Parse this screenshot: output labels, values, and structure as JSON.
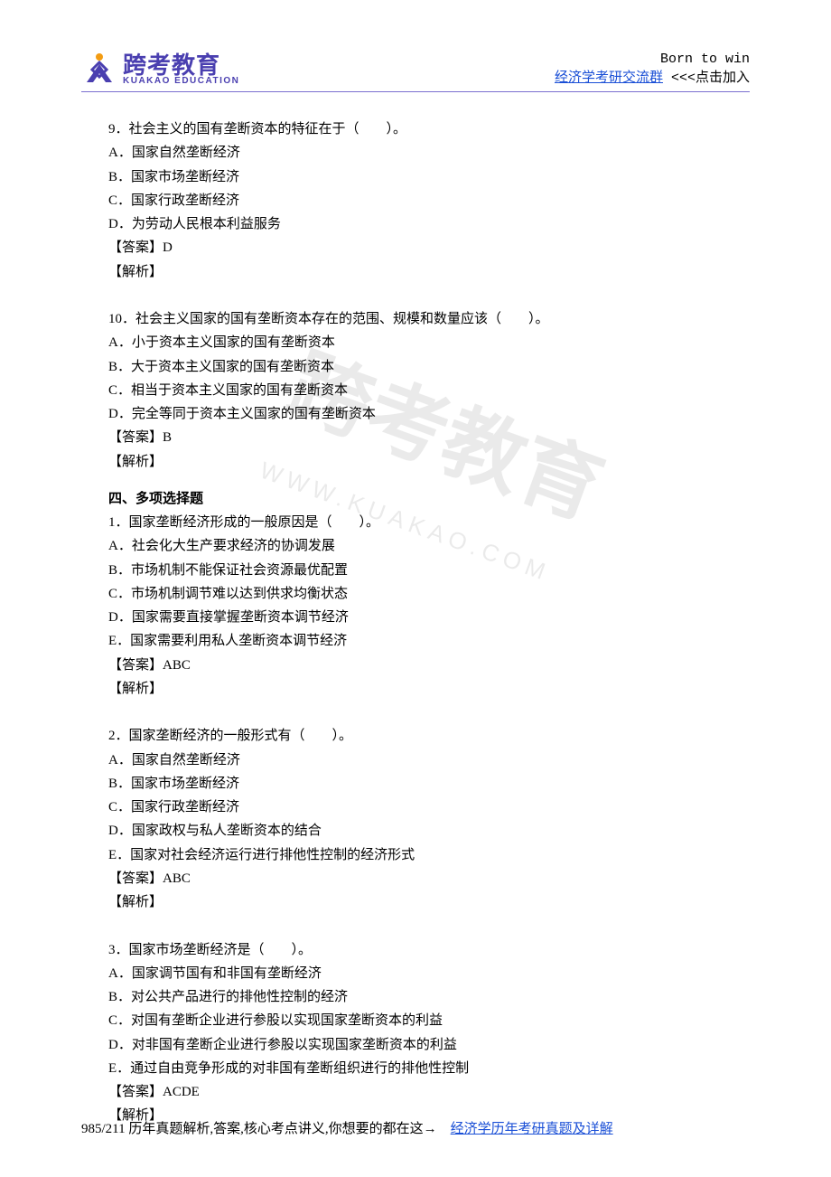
{
  "header": {
    "logo_cn": "跨考教育",
    "logo_en": "KUAKAO EDUCATION",
    "slogan": "Born to win",
    "link_text": "经济学考研交流群",
    "hint": " <<<点击加入"
  },
  "watermark": {
    "cn": "跨考教育",
    "en": "WWW.KUAKAO.COM"
  },
  "questions": [
    {
      "stem": "9．社会主义的国有垄断资本的特征在于（　　）。",
      "options": [
        "A．国家自然垄断经济",
        "B．国家市场垄断经济",
        "C．国家行政垄断经济",
        "D．为劳动人民根本利益服务"
      ],
      "answer": "【答案】D",
      "analysis": "【解析】"
    },
    {
      "stem": "10．社会主义国家的国有垄断资本存在的范围、规模和数量应该（　　）。",
      "options": [
        "A．小于资本主义国家的国有垄断资本",
        "B．大于资本主义国家的国有垄断资本",
        "C．相当于资本主义国家的国有垄断资本",
        "D．完全等同于资本主义国家的国有垄断资本"
      ],
      "answer": "【答案】B",
      "analysis": "【解析】"
    }
  ],
  "section_title": "四、多项选择题",
  "multi_questions": [
    {
      "stem": "1．国家垄断经济形成的一般原因是（　　）。",
      "options": [
        "A．社会化大生产要求经济的协调发展",
        "B．市场机制不能保证社会资源最优配置",
        "C．市场机制调节难以达到供求均衡状态",
        "D．国家需要直接掌握垄断资本调节经济",
        "E．国家需要利用私人垄断资本调节经济"
      ],
      "answer": "【答案】ABC",
      "analysis": "【解析】"
    },
    {
      "stem": "2．国家垄断经济的一般形式有（　　）。",
      "options": [
        "A．国家自然垄断经济",
        "B．国家市场垄断经济",
        "C．国家行政垄断经济",
        "D．国家政权与私人垄断资本的结合",
        "E．国家对社会经济运行进行排他性控制的经济形式"
      ],
      "answer": "【答案】ABC",
      "analysis": "【解析】"
    },
    {
      "stem": "3．国家市场垄断经济是（　　）。",
      "options": [
        "A．国家调节国有和非国有垄断经济",
        "B．对公共产品进行的排他性控制的经济",
        "C．对国有垄断企业进行参股以实现国家垄断资本的利益",
        "D．对非国有垄断企业进行参股以实现国家垄断资本的利益",
        "E．通过自由竞争形成的对非国有垄断组织进行的排他性控制"
      ],
      "answer": "【答案】ACDE",
      "analysis": "【解析】"
    }
  ],
  "footer": {
    "text": "985/211 历年真题解析,答案,核心考点讲义,你想要的都在这→　",
    "link": "经济学历年考研真题及详解"
  }
}
